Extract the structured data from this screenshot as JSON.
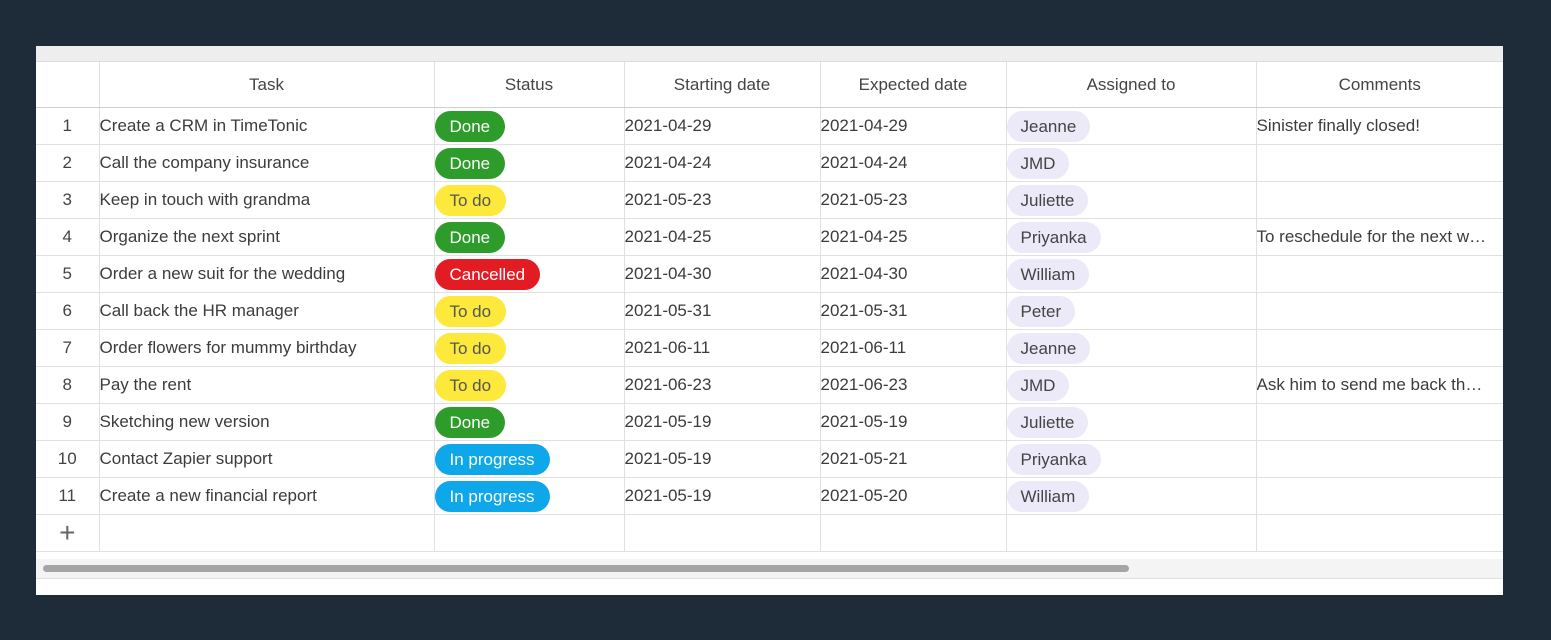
{
  "columns": [
    "",
    "Task",
    "Status",
    "Starting date",
    "Expected date",
    "Assigned to",
    "Comments"
  ],
  "rows": [
    {
      "num": "1",
      "task": "Create a CRM in TimeTonic",
      "status": "Done",
      "status_type": "done",
      "start": "2021-04-29",
      "expected": "2021-04-29",
      "assignee": "Jeanne",
      "comment": "Sinister finally closed!"
    },
    {
      "num": "2",
      "task": "Call the company insurance",
      "status": "Done",
      "status_type": "done",
      "start": "2021-04-24",
      "expected": "2021-04-24",
      "assignee": "JMD",
      "comment": ""
    },
    {
      "num": "3",
      "task": "Keep in touch with grandma",
      "status": "To do",
      "status_type": "todo",
      "start": "2021-05-23",
      "expected": "2021-05-23",
      "assignee": "Juliette",
      "comment": ""
    },
    {
      "num": "4",
      "task": "Organize the next sprint",
      "status": "Done",
      "status_type": "done",
      "start": "2021-04-25",
      "expected": "2021-04-25",
      "assignee": "Priyanka",
      "comment": "To reschedule for the next w…"
    },
    {
      "num": "5",
      "task": "Order a new suit for the wedding",
      "status": "Cancelled",
      "status_type": "cancelled",
      "start": "2021-04-30",
      "expected": "2021-04-30",
      "assignee": "William",
      "comment": ""
    },
    {
      "num": "6",
      "task": "Call back the HR manager",
      "status": "To do",
      "status_type": "todo",
      "start": "2021-05-31",
      "expected": "2021-05-31",
      "assignee": "Peter",
      "comment": ""
    },
    {
      "num": "7",
      "task": "Order flowers for mummy birthday",
      "status": "To do",
      "status_type": "todo",
      "start": "2021-06-11",
      "expected": "2021-06-11",
      "assignee": "Jeanne",
      "comment": ""
    },
    {
      "num": "8",
      "task": "Pay the rent",
      "status": "To do",
      "status_type": "todo",
      "start": "2021-06-23",
      "expected": "2021-06-23",
      "assignee": "JMD",
      "comment": "Ask him to send me back th…"
    },
    {
      "num": "9",
      "task": "Sketching new version",
      "status": "Done",
      "status_type": "done",
      "start": "2021-05-19",
      "expected": "2021-05-19",
      "assignee": "Juliette",
      "comment": ""
    },
    {
      "num": "10",
      "task": "Contact Zapier support",
      "status": "In progress",
      "status_type": "progress",
      "start": "2021-05-19",
      "expected": "2021-05-21",
      "assignee": "Priyanka",
      "comment": ""
    },
    {
      "num": "11",
      "task": "Create a new financial report",
      "status": "In progress",
      "status_type": "progress",
      "start": "2021-05-19",
      "expected": "2021-05-20",
      "assignee": "William",
      "comment": ""
    }
  ],
  "add_row_icon": "plus-icon",
  "status_colors": {
    "done": "#2e9c2a",
    "todo": "#fde93b",
    "cancelled": "#e31b23",
    "progress": "#0ea7e9"
  },
  "assignee_chip_color": "#ece9f8"
}
